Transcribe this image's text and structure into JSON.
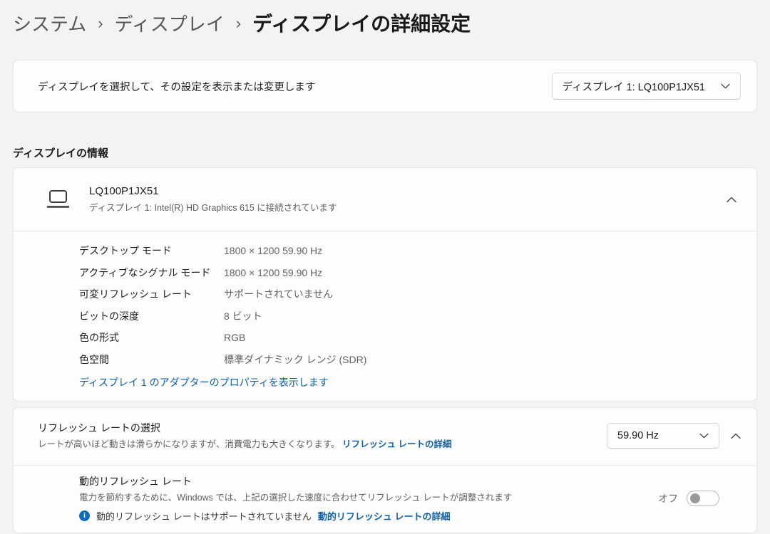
{
  "breadcrumb": {
    "items": [
      "システム",
      "ディスプレイ"
    ],
    "separator": "›",
    "current": "ディスプレイの詳細設定"
  },
  "display_select": {
    "label": "ディスプレイを選択して、その設定を表示または変更します",
    "dropdown_value": "ディスプレイ 1: LQ100P1JX51"
  },
  "display_info": {
    "section_title": "ディスプレイの情報",
    "title": "LQ100P1JX51",
    "subtitle": "ディスプレイ 1: Intel(R) HD Graphics 615 に接続されています",
    "rows": [
      {
        "label": "デスクトップ モード",
        "value": "1800 × 1200 59.90 Hz"
      },
      {
        "label": "アクティブなシグナル モード",
        "value": "1800 × 1200 59.90 Hz"
      },
      {
        "label": "可変リフレッシュ レート",
        "value": "サポートされていません"
      },
      {
        "label": "ビットの深度",
        "value": "8 ビット"
      },
      {
        "label": "色の形式",
        "value": "RGB"
      },
      {
        "label": "色空間",
        "value": "標準ダイナミック レンジ (SDR)"
      }
    ],
    "adapter_link": "ディスプレイ 1 のアダプターのプロパティを表示します"
  },
  "refresh_rate": {
    "title": "リフレッシュ レートの選択",
    "description": "レートが高いほど動きは滑らかになりますが、消費電力も大きくなります。",
    "learn_more_link": "リフレッシュ レートの詳細",
    "dropdown_value": "59.90 Hz"
  },
  "dynamic_refresh": {
    "title": "動的リフレッシュ レート",
    "description": "電力を節約するために、Windows では、上記の選択した速度に合わせてリフレッシュ レートが調整されます",
    "info_status": "動的リフレッシュ レートはサポートされていません",
    "learn_more_link": "動的リフレッシュ レートの詳細",
    "toggle_label": "オフ",
    "toggle_state": "off",
    "info_icon_glyph": "i"
  },
  "icons": {
    "laptop_icon": "laptop-outline",
    "chevron_down_icon": "⌄",
    "chevron_up_icon": "⌃",
    "info_icon": "ⓘ"
  },
  "colors": {
    "page_background": "#f3f3f3",
    "card_background": "#fdfdfd",
    "card_border": "#e6e6e6",
    "link_blue": "#0f5fa8",
    "info_icon_blue": "#0f6cbd",
    "text_primary": "#1b1b1b",
    "text_secondary": "#5f5f5f"
  }
}
